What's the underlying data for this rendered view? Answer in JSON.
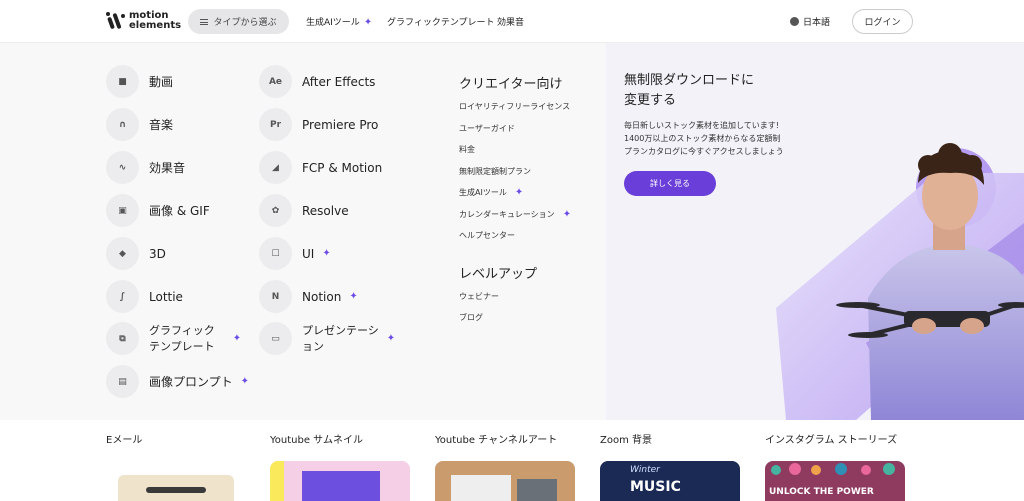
{
  "brand": {
    "name_line1": "motion",
    "name_line2": "elements"
  },
  "header": {
    "type_button": "タイプから選ぶ",
    "nav": [
      "生成AIツール",
      "グラフィックテンプレート",
      "効果音"
    ],
    "lang": "日本語",
    "login": "ログイン"
  },
  "menu": {
    "col1": [
      {
        "label": "動画",
        "icon": "video-icon",
        "glyph": "■"
      },
      {
        "label": "音楽",
        "icon": "headphones-icon",
        "glyph": "∩"
      },
      {
        "label": "効果音",
        "icon": "waveform-icon",
        "glyph": "∿"
      },
      {
        "label": "画像 & GIF",
        "icon": "image-icon",
        "glyph": "▣"
      },
      {
        "label": "3D",
        "icon": "cube-icon",
        "glyph": "◆"
      },
      {
        "label": "Lottie",
        "icon": "lottie-icon",
        "glyph": "∫"
      }
    ],
    "col1_extra": [
      {
        "label1": "グラフィック",
        "label2": "テンプレート",
        "icon": "graphic-template-icon",
        "glyph": "⧉"
      },
      {
        "label": "画像プロンプト",
        "icon": "image-prompt-icon",
        "glyph": "▤"
      }
    ],
    "col2": [
      {
        "label": "After Effects",
        "icon": "after-effects-icon",
        "glyph": "Ae"
      },
      {
        "label": "Premiere Pro",
        "icon": "premiere-pro-icon",
        "glyph": "Pr"
      },
      {
        "label": "FCP & Motion",
        "icon": "fcp-icon",
        "glyph": "◢"
      },
      {
        "label": "Resolve",
        "icon": "resolve-icon",
        "glyph": "✿"
      },
      {
        "label": "UI",
        "icon": "ui-icon",
        "glyph": "☐"
      },
      {
        "label": "Notion",
        "icon": "notion-icon",
        "glyph": "N"
      }
    ],
    "col2_extra": {
      "label1": "プレゼンテーシ",
      "label2": "ョン",
      "icon": "presentation-icon",
      "glyph": "▭"
    },
    "creators_heading": "クリエイター向け",
    "creators": [
      "ロイヤリティフリーライセンス",
      "ユーザーガイド",
      "料金",
      "無制限定額制プラン",
      "生成AIツール",
      "カレンダーキュレーション",
      "ヘルプセンター"
    ],
    "levelup_heading": "レベルアップ",
    "levelup": [
      "ウェビナー",
      "ブログ"
    ]
  },
  "promo": {
    "title_line1": "無制限ダウンロードに",
    "title_line2": "変更する",
    "text_line1": "毎日新しいストック素材を追加しています!",
    "text_line2": "1400万以上のストック素材からなる定額制",
    "text_line3": "プランカタログに今すぐアクセスしましょう",
    "button": "詳しく見る"
  },
  "cards": [
    {
      "label": "Eメール"
    },
    {
      "label": "Youtube サムネイル"
    },
    {
      "label": "Youtube チャンネルアート"
    },
    {
      "label": "Zoom 背景",
      "thumb_line1": "Winter",
      "thumb_line2": "MUSIC"
    },
    {
      "label": "インスタグラム ストーリーズ",
      "thumb_text": "UNLOCK THE POWER"
    }
  ],
  "colors": {
    "accent": "#6a3ed8",
    "sparkle": "#6b4ce6",
    "panel": "#f8f8f9"
  }
}
